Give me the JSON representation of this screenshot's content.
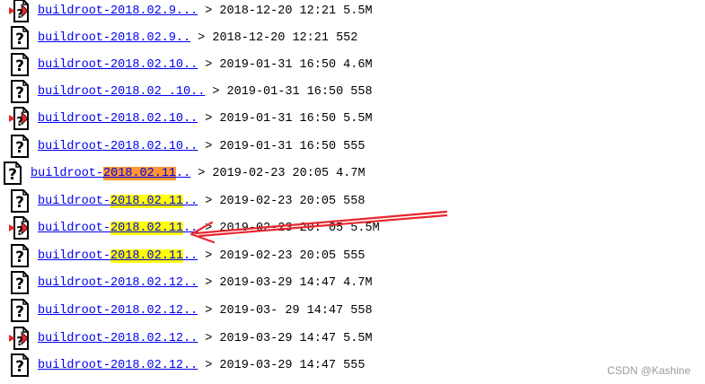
{
  "listing": {
    "rows": [
      {
        "icon": "unknown-file-icon-red",
        "link_prefix": "buildroot-2018.02.9...",
        "link_hl": "",
        "link_suffix": "",
        "meta": "> 2018-12-20 12:21 5.5M"
      },
      {
        "icon": "unknown-file-icon",
        "link_prefix": "buildroot-2018.02.9..",
        "link_hl": "",
        "link_suffix": "",
        "meta": "> 2018-12-20 12:21 552"
      },
      {
        "icon": "unknown-file-icon",
        "link_prefix": "buildroot-2018.02.10..",
        "link_hl": "",
        "link_suffix": "",
        "meta": "> 2019-01-31 16:50 4.6M"
      },
      {
        "icon": "unknown-file-icon",
        "link_prefix": "buildroot-2018.02 .10..",
        "link_hl": "",
        "link_suffix": "",
        "meta": "> 2019-01-31 16:50 558"
      },
      {
        "icon": "unknown-file-icon-red",
        "link_prefix": "buildroot-2018.02.10..",
        "link_hl": "",
        "link_suffix": "",
        "meta": "> 2019-01-31 16:50 5.5M"
      },
      {
        "icon": "unknown-file-icon",
        "link_prefix": "buildroot-2018.02.10..",
        "link_hl": "",
        "link_suffix": "",
        "meta": "> 2019-01-31 16:50 555"
      },
      {
        "icon": "unknown-file-icon",
        "link_prefix": "buildroot-",
        "link_hl": "2018.02.11",
        "link_suffix": "..",
        "meta": "> 2019-02-23 20:05 4.7M",
        "hl_color": "orange"
      },
      {
        "icon": "unknown-file-icon",
        "link_prefix": "buildroot-",
        "link_hl": "2018.02.11",
        "link_suffix": "..",
        "meta": "> 2019-02-23 20:05 558",
        "hl_color": "yellow"
      },
      {
        "icon": "unknown-file-icon-red",
        "link_prefix": "buildroot-",
        "link_hl": "2018.02.11",
        "link_suffix": "..",
        "meta": "> 2019-02-23 20: 05 5.5M",
        "hl_color": "yellow"
      },
      {
        "icon": "unknown-file-icon",
        "link_prefix": "buildroot-",
        "link_hl": "2018.02.11",
        "link_suffix": "..",
        "meta": "> 2019-02-23 20:05 555",
        "hl_color": "yellow"
      },
      {
        "icon": "unknown-file-icon",
        "link_prefix": "buildroot-2018.02.12..",
        "link_hl": "",
        "link_suffix": "",
        "meta": "> 2019-03-29 14:47 4.7M"
      },
      {
        "icon": "unknown-file-icon",
        "link_prefix": "buildroot-2018.02.12..",
        "link_hl": "",
        "link_suffix": "",
        "meta": "> 2019-03- 29 14:47 558"
      },
      {
        "icon": "unknown-file-icon-red",
        "link_prefix": "buildroot-2018.02.12..",
        "link_hl": "",
        "link_suffix": "",
        "meta": "> 2019-03-29 14:47 5.5M"
      },
      {
        "icon": "unknown-file-icon",
        "link_prefix": "buildroot-2018.02.12..",
        "link_hl": "",
        "link_suffix": "",
        "meta": "> 2019-03-29 14:47 555"
      }
    ]
  },
  "annotation": {
    "arrow_color": "#e8262d"
  },
  "watermark": {
    "text": "CSDN @Kashine"
  }
}
